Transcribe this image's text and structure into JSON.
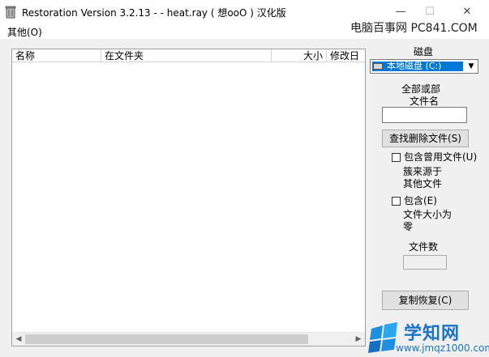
{
  "window": {
    "title": "Restoration Version 3.2.13   -  - heat.ray ( 想ooO ) 汉化版",
    "minimize_glyph": "—",
    "maximize_glyph": "☐",
    "close_glyph": "✕"
  },
  "menu": {
    "items": [
      {
        "label": "其他(O)"
      }
    ]
  },
  "watermark": {
    "text": "电脑百事网 PC841.COM"
  },
  "file_list": {
    "columns": [
      "名称",
      "在文件夹",
      "大小",
      "修改日"
    ],
    "rows": []
  },
  "panel": {
    "drive_label": "磁盘",
    "drive_selected": "本地磁盘 (C:)",
    "filename_label_line1": "全部或部",
    "filename_label_line2": "文件名",
    "filename_value": "",
    "search_button": "查找删除文件(S)",
    "include_used_label": "包含曾用文件(U)",
    "include_used_note_line1": "簇来源于",
    "include_used_note_line2": "其他文件",
    "include_zero_label": "包含(E)",
    "include_zero_note_line1": "文件大小为",
    "include_zero_note_line2": "零",
    "file_count_label": "文件数",
    "file_count_value": "",
    "restore_button": "复制恢复(C)"
  },
  "logo": {
    "text": "学知网",
    "url": "www.jmqz1000.com"
  },
  "colors": {
    "selection": "#0078d7",
    "logo": "#1a73c8",
    "panel_bg": "#f0f0f0"
  }
}
